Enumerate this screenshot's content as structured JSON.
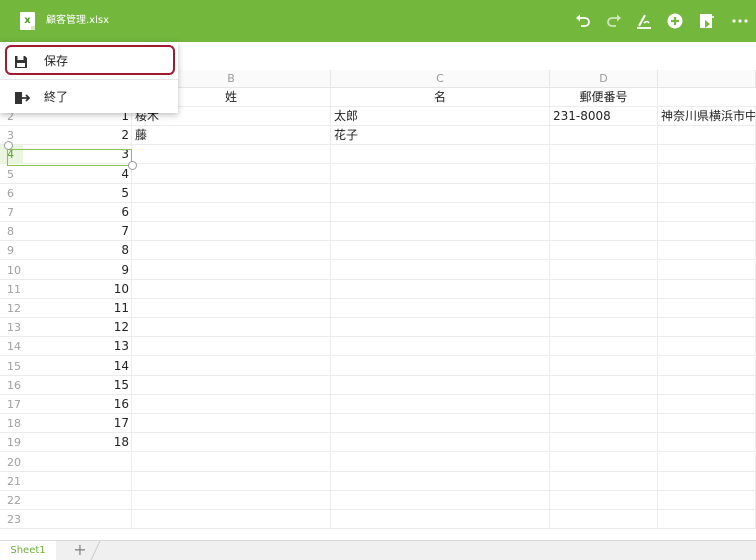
{
  "app": {
    "title": "顧客管理.xlsx",
    "accent_color": "#73b73d",
    "toolbar_icons": [
      "undo-icon",
      "redo-icon",
      "format-pen-icon",
      "add-circle-icon",
      "share-doc-icon",
      "more-icon"
    ]
  },
  "menu": {
    "items": [
      {
        "label": "保存",
        "icon": "save-icon"
      },
      {
        "label": "終了",
        "icon": "exit-icon"
      }
    ],
    "highlight_color": "#a11a2f"
  },
  "sheet": {
    "columns": [
      "B",
      "C",
      "D"
    ],
    "header_row": {
      "b": "姓",
      "c": "名",
      "d": "郵便番号"
    },
    "rows": [
      {
        "num": "2",
        "a": "1",
        "b": "桜木",
        "c": "太郎",
        "d": "231-8008",
        "e": "神奈川県横浜市中区"
      },
      {
        "num": "3",
        "a": "2",
        "b": "藤",
        "c": "花子",
        "d": "",
        "e": ""
      },
      {
        "num": "4",
        "a": "3",
        "b": "",
        "c": "",
        "d": "",
        "e": ""
      },
      {
        "num": "5",
        "a": "4",
        "b": "",
        "c": "",
        "d": "",
        "e": ""
      },
      {
        "num": "6",
        "a": "5",
        "b": "",
        "c": "",
        "d": "",
        "e": ""
      },
      {
        "num": "7",
        "a": "6",
        "b": "",
        "c": "",
        "d": "",
        "e": ""
      },
      {
        "num": "8",
        "a": "7",
        "b": "",
        "c": "",
        "d": "",
        "e": ""
      },
      {
        "num": "9",
        "a": "8",
        "b": "",
        "c": "",
        "d": "",
        "e": ""
      },
      {
        "num": "10",
        "a": "9",
        "b": "",
        "c": "",
        "d": "",
        "e": ""
      },
      {
        "num": "11",
        "a": "10",
        "b": "",
        "c": "",
        "d": "",
        "e": ""
      },
      {
        "num": "12",
        "a": "11",
        "b": "",
        "c": "",
        "d": "",
        "e": ""
      },
      {
        "num": "13",
        "a": "12",
        "b": "",
        "c": "",
        "d": "",
        "e": ""
      },
      {
        "num": "14",
        "a": "13",
        "b": "",
        "c": "",
        "d": "",
        "e": ""
      },
      {
        "num": "15",
        "a": "14",
        "b": "",
        "c": "",
        "d": "",
        "e": ""
      },
      {
        "num": "16",
        "a": "15",
        "b": "",
        "c": "",
        "d": "",
        "e": ""
      },
      {
        "num": "17",
        "a": "16",
        "b": "",
        "c": "",
        "d": "",
        "e": ""
      },
      {
        "num": "18",
        "a": "17",
        "b": "",
        "c": "",
        "d": "",
        "e": ""
      },
      {
        "num": "19",
        "a": "18",
        "b": "",
        "c": "",
        "d": "",
        "e": ""
      },
      {
        "num": "20",
        "a": "",
        "b": "",
        "c": "",
        "d": "",
        "e": ""
      },
      {
        "num": "21",
        "a": "",
        "b": "",
        "c": "",
        "d": "",
        "e": ""
      },
      {
        "num": "22",
        "a": "",
        "b": "",
        "c": "",
        "d": "",
        "e": ""
      },
      {
        "num": "23",
        "a": "",
        "b": "",
        "c": "",
        "d": "",
        "e": ""
      }
    ],
    "selected_row": "4"
  },
  "tabs": {
    "sheet_name": "Sheet1",
    "add_label": "+"
  }
}
